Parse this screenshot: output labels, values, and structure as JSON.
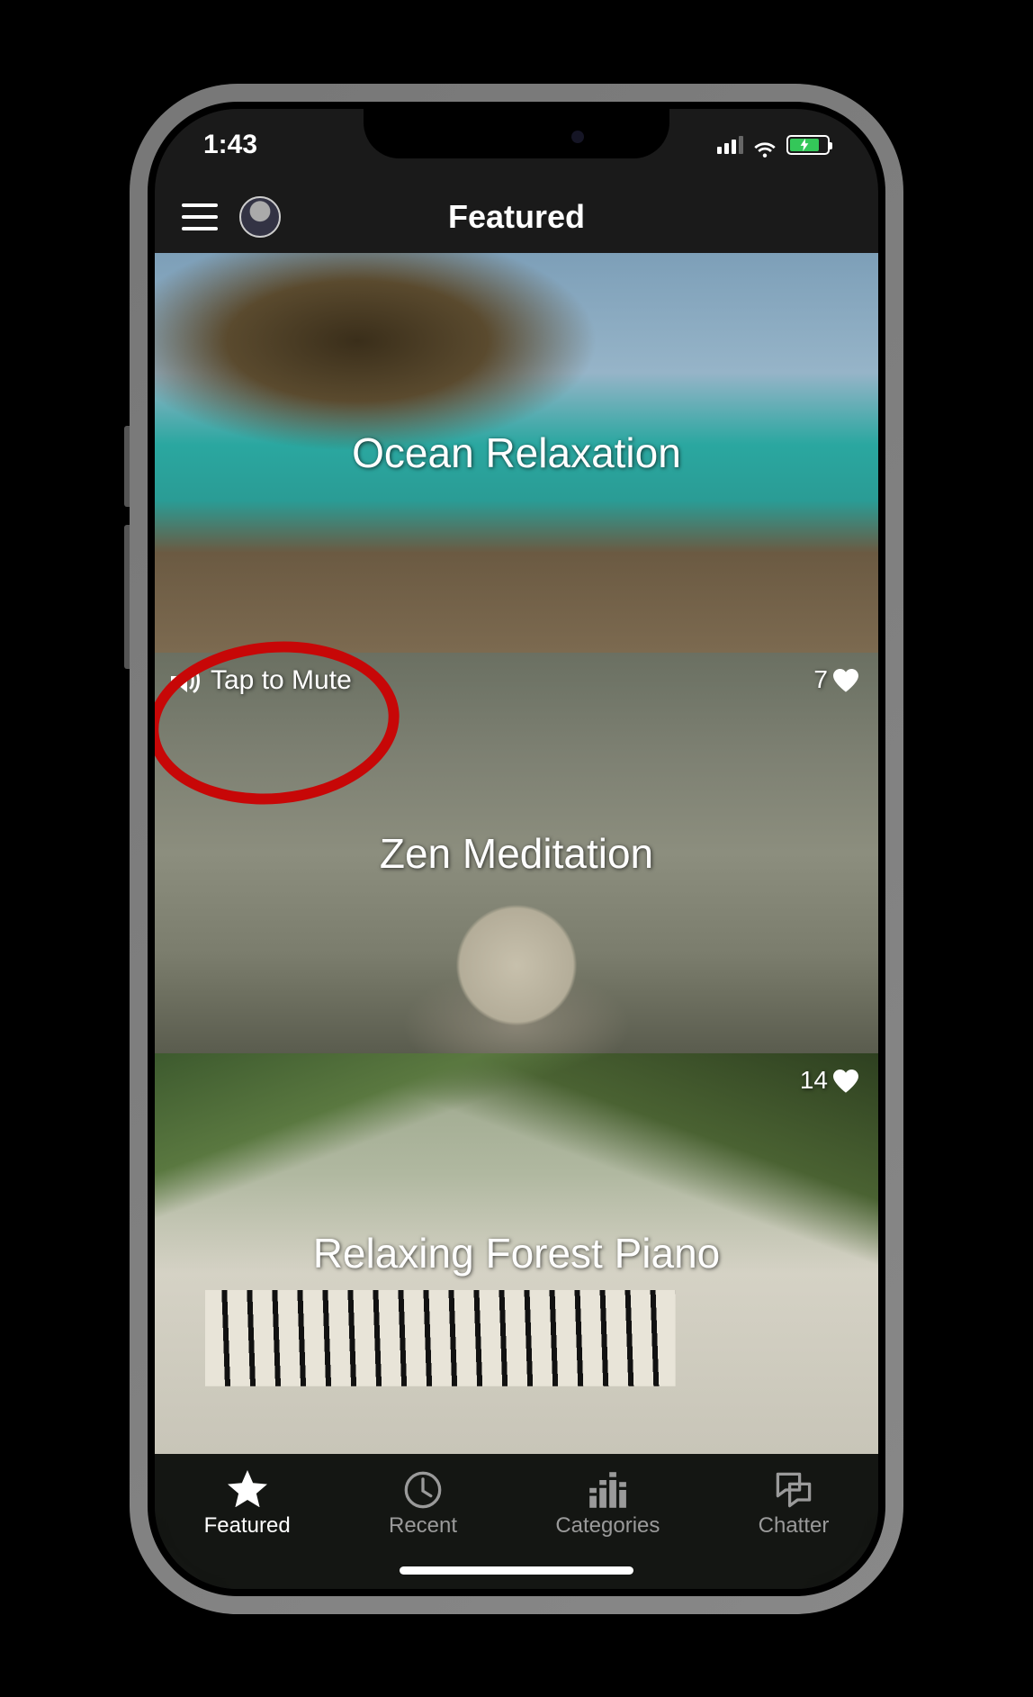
{
  "status_bar": {
    "time": "1:43"
  },
  "nav": {
    "title": "Featured"
  },
  "cards": [
    {
      "title": "Ocean Relaxation",
      "likes": null,
      "mute_label": null
    },
    {
      "title": "Zen Meditation",
      "likes": "7",
      "mute_label": "Tap to Mute"
    },
    {
      "title": "Relaxing Forest Piano",
      "likes": "14",
      "mute_label": null
    }
  ],
  "tabs": [
    {
      "label": "Featured",
      "active": true
    },
    {
      "label": "Recent",
      "active": false
    },
    {
      "label": "Categories",
      "active": false
    },
    {
      "label": "Chatter",
      "active": false
    }
  ],
  "colors": {
    "annotation": "#e20000",
    "battery_charging": "#34c759"
  }
}
